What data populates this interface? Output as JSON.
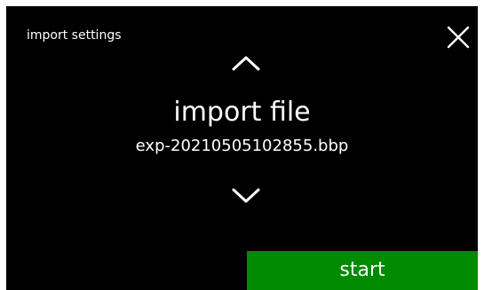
{
  "header": {
    "title": "import settings",
    "close_icon": "close-icon"
  },
  "selector": {
    "up_icon": "chevron-up-icon",
    "down_icon": "chevron-down-icon",
    "setting_name": "import file",
    "setting_value": "exp-20210505102855.bbp"
  },
  "actions": {
    "start_label": "start"
  },
  "colors": {
    "background": "#000000",
    "text": "#ffffff",
    "start_button": "#008A00"
  }
}
